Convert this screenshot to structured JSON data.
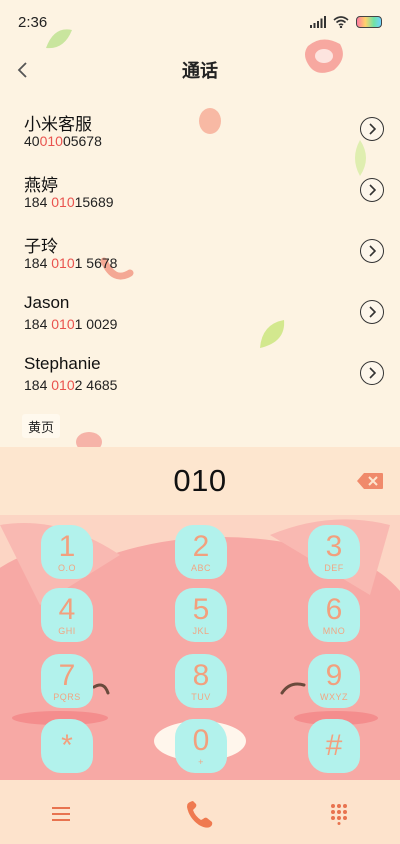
{
  "status_bar": {
    "time": "2:36"
  },
  "header": {
    "title": "通话",
    "back_icon": "chevron-left-icon"
  },
  "results": [
    {
      "name": "小米客服",
      "number_parts": [
        "40",
        "010",
        "05678"
      ]
    },
    {
      "name": "燕婷",
      "number_parts": [
        "184 ",
        "010",
        "15689"
      ]
    },
    {
      "name": "子玲",
      "number_parts": [
        "184 ",
        "010",
        "1 5678"
      ]
    },
    {
      "name": "Jason",
      "number_parts": [
        "184 ",
        "010",
        "1 0029"
      ]
    },
    {
      "name": "Stephanie",
      "number_parts": [
        "184 ",
        "010",
        "2 4685"
      ]
    }
  ],
  "yellow_pages": {
    "label": "黄页"
  },
  "dial_input": {
    "value": "010"
  },
  "keypad": [
    {
      "digit": "1",
      "letters": "O.O"
    },
    {
      "digit": "2",
      "letters": "ABC"
    },
    {
      "digit": "3",
      "letters": "DEF"
    },
    {
      "digit": "4",
      "letters": "GHI"
    },
    {
      "digit": "5",
      "letters": "JKL"
    },
    {
      "digit": "6",
      "letters": "MNO"
    },
    {
      "digit": "7",
      "letters": "PQRS"
    },
    {
      "digit": "8",
      "letters": "TUV"
    },
    {
      "digit": "9",
      "letters": "WXYZ"
    },
    {
      "digit": "*",
      "letters": ""
    },
    {
      "digit": "0",
      "letters": "+"
    },
    {
      "digit": "#",
      "letters": ""
    }
  ],
  "colors": {
    "highlight": "#e9534e",
    "key_fill": "#b2f2ec",
    "key_text": "#f2a07e",
    "call_button": "#ef7a50"
  },
  "bottom_bar": {
    "menu_icon": "menu-icon",
    "call_icon": "phone-icon",
    "dialpad_icon": "dialpad-icon"
  }
}
